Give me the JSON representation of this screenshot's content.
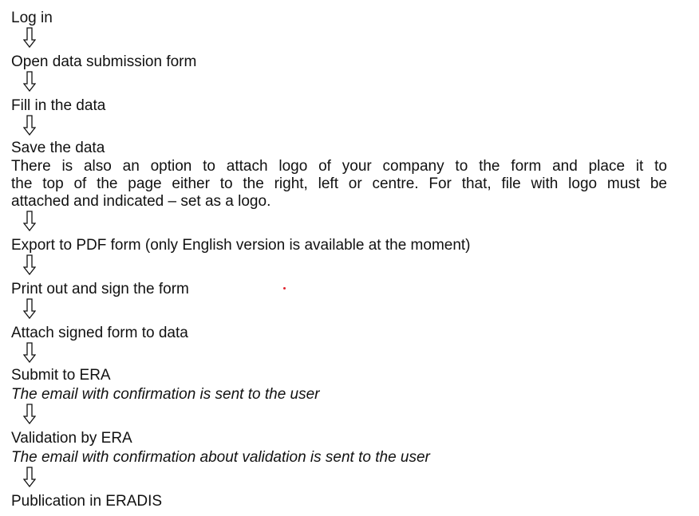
{
  "steps": [
    "Log in",
    "Open data submission form",
    "Fill in the data",
    "Save the data",
    "Export to PDF form (only English version is available at the moment)",
    "Print out and sign the form",
    "Attach signed form to data",
    "Submit to ERA",
    "Validation by ERA",
    "Publication in ERADIS"
  ],
  "save_note_lines": [
    "There is also an option to attach logo of your company to the form and place it to",
    "the top of the page either to the right, left or centre. For that, file with logo must be",
    "attached and indicated – set as a logo."
  ],
  "notes": {
    "submit": "The email with confirmation is sent to the user",
    "validation": "The email with confirmation about validation is sent to the user"
  },
  "icons": {
    "arrow": "down-arrow-icon"
  },
  "colors": {
    "text": "#111111",
    "arrow": "#111111",
    "speck": "#e0232e"
  }
}
